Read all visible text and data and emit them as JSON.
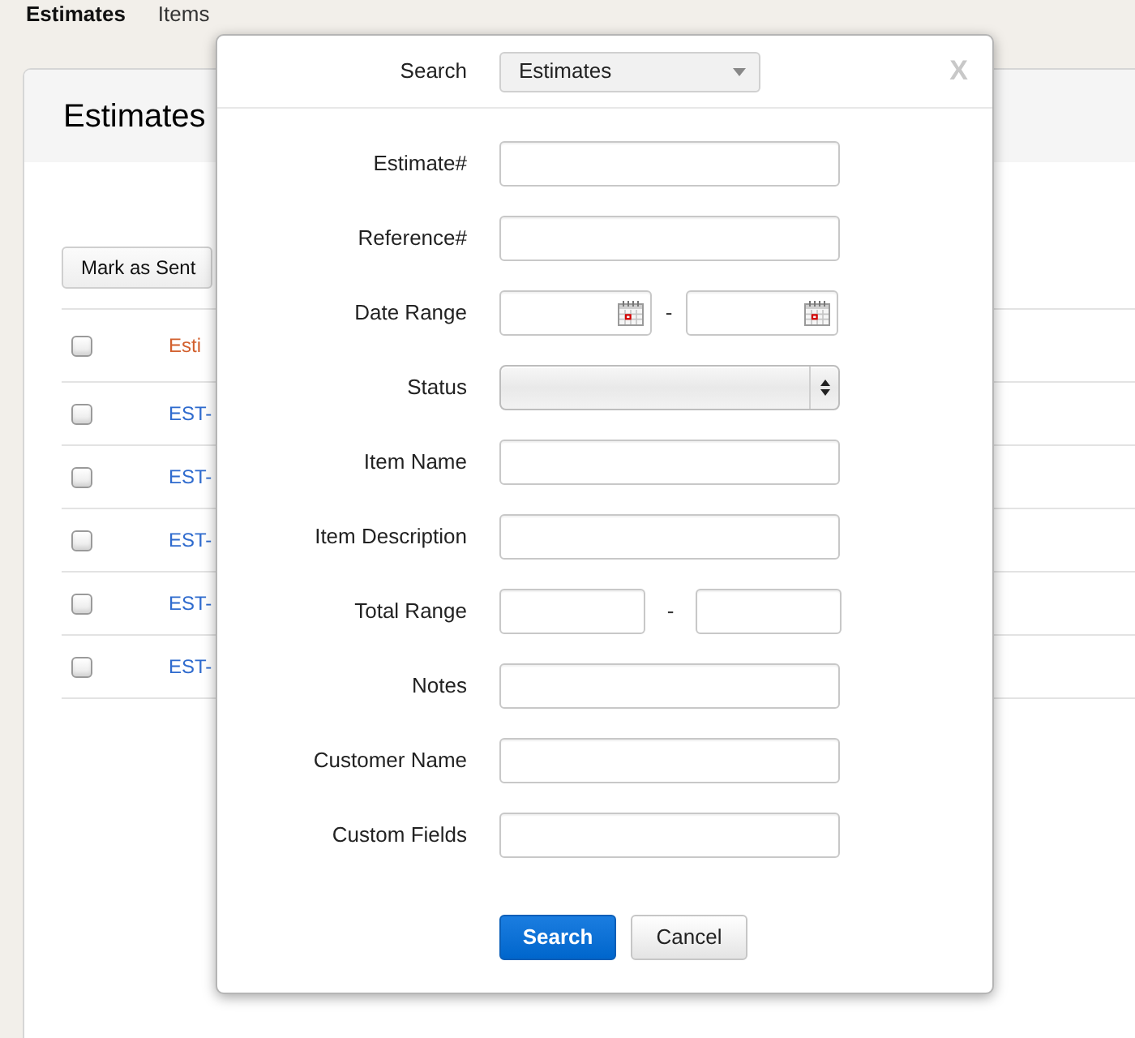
{
  "nav": {
    "tabs": [
      {
        "label": "Estimates",
        "selected": true
      },
      {
        "label": "Items",
        "selected": false
      }
    ]
  },
  "page": {
    "title": "Estimates",
    "toolbar": {
      "buttons": [
        "Mark as Sent"
      ]
    },
    "table": {
      "header": {
        "checked": false,
        "column_2": "Esti"
      },
      "rows": [
        {
          "checked": false,
          "column_2": "EST-"
        },
        {
          "checked": false,
          "column_2": "EST-"
        },
        {
          "checked": false,
          "column_2": "EST-"
        },
        {
          "checked": false,
          "column_2": "EST-"
        },
        {
          "checked": false,
          "column_2": "EST-"
        }
      ]
    }
  },
  "search_dialog": {
    "search_label": "Search",
    "search_in": "Estimates",
    "close": "X",
    "fields": [
      {
        "kind": "text",
        "label": "Estimate#"
      },
      {
        "kind": "text",
        "label": "Reference#"
      },
      {
        "kind": "date_range",
        "label": "Date Range",
        "separator": "-"
      },
      {
        "kind": "select",
        "label": "Status"
      },
      {
        "kind": "text",
        "label": "Item Name"
      },
      {
        "kind": "text",
        "label": "Item Description"
      },
      {
        "kind": "number_range",
        "label": "Total Range",
        "separator": "-"
      },
      {
        "kind": "text",
        "label": "Notes"
      },
      {
        "kind": "text",
        "label": "Customer Name"
      },
      {
        "kind": "text",
        "label": "Custom Fields"
      }
    ],
    "buttons": [
      {
        "kind": "primary",
        "label": "Search"
      },
      {
        "kind": "secondary",
        "label": "Cancel"
      }
    ]
  }
}
